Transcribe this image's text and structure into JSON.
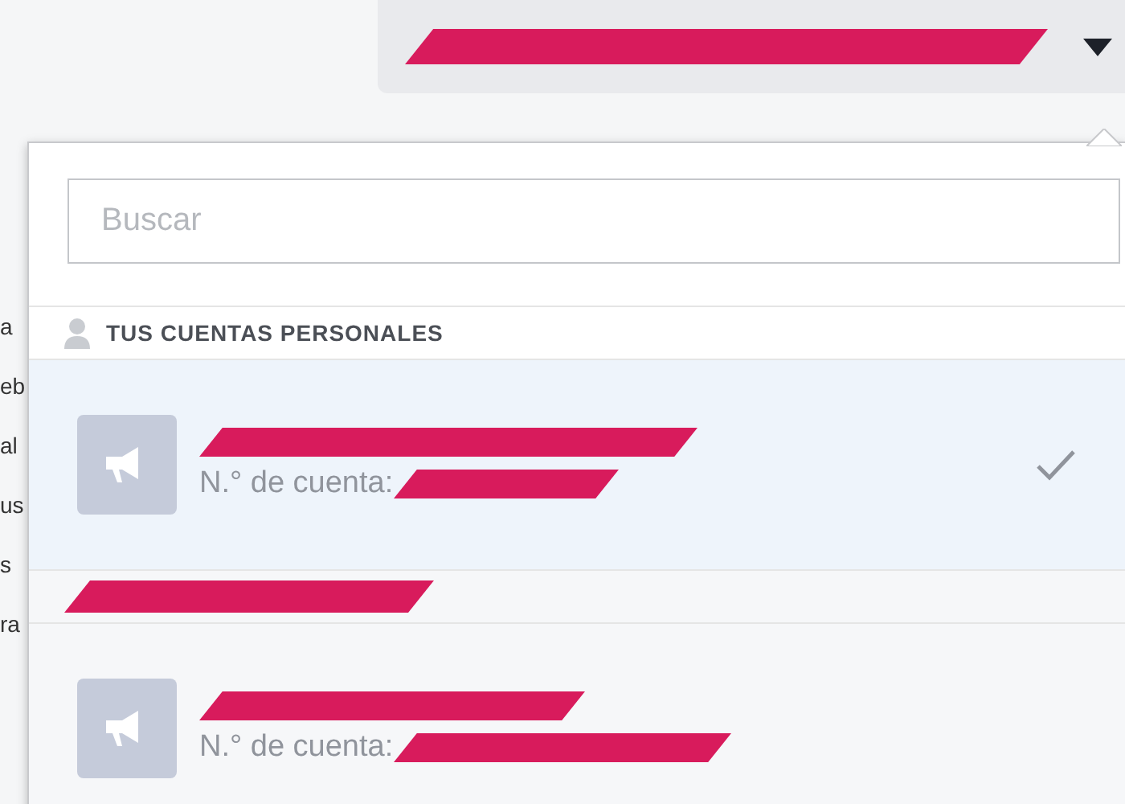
{
  "background_text": [
    "a",
    "eb",
    "al",
    "us",
    "s",
    "ra"
  ],
  "search": {
    "placeholder": "Buscar"
  },
  "sections": [
    {
      "title": "TUS CUENTAS PERSONALES",
      "accounts": [
        {
          "number_label": "N.° de cuenta:",
          "selected": true
        }
      ]
    },
    {
      "accounts": [
        {
          "number_label": "N.° de cuenta:",
          "selected": false
        }
      ]
    }
  ]
}
